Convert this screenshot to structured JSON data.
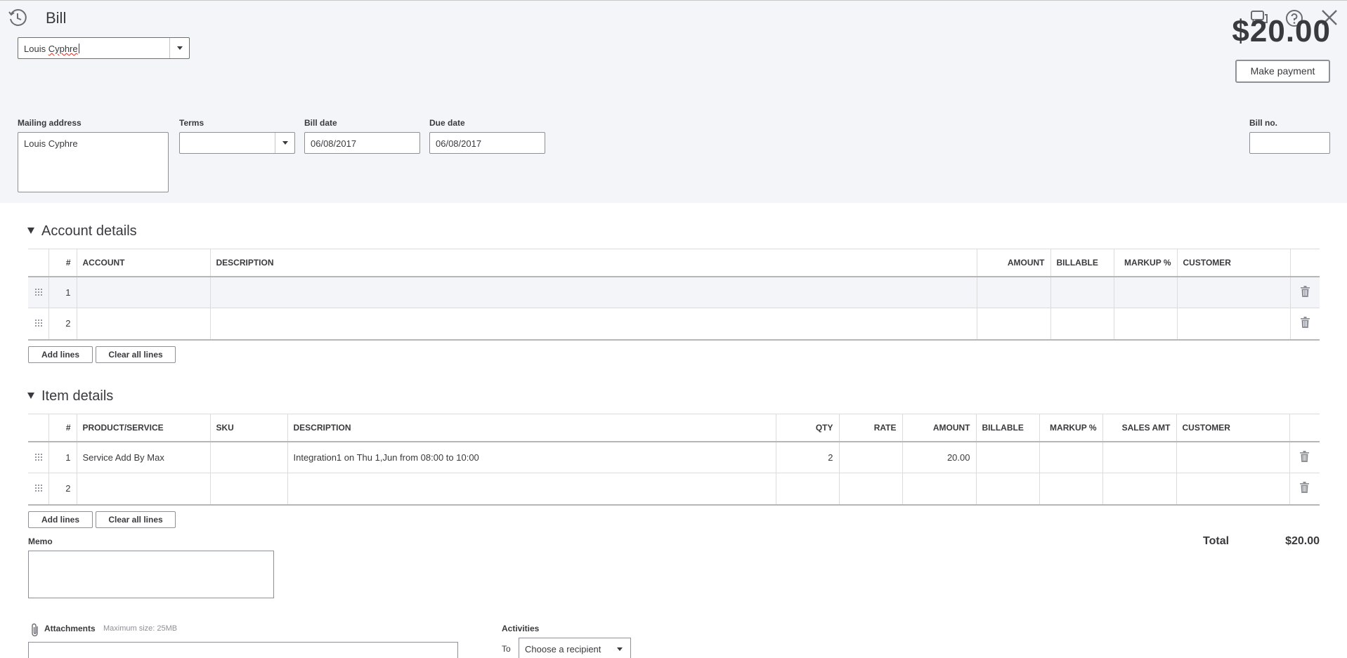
{
  "header": {
    "title": "Bill",
    "vendor": {
      "first": "Louis ",
      "squiggled": "Cyphre"
    },
    "balance_display": "$20.00",
    "make_payment_label": "Make payment",
    "mailing_address_label": "Mailing address",
    "mailing_address_value": "Louis Cyphre",
    "terms_label": "Terms",
    "terms_value": "",
    "bill_date_label": "Bill date",
    "bill_date_value": "06/08/2017",
    "due_date_label": "Due date",
    "due_date_value": "06/08/2017",
    "bill_no_label": "Bill no.",
    "bill_no_value": ""
  },
  "account_details": {
    "title": "Account details",
    "columns": [
      "#",
      "ACCOUNT",
      "DESCRIPTION",
      "AMOUNT",
      "BILLABLE",
      "MARKUP %",
      "CUSTOMER"
    ],
    "rows": [
      {
        "num": "1",
        "account": "",
        "description": "",
        "amount": "",
        "billable": "",
        "markup": "",
        "customer": ""
      },
      {
        "num": "2",
        "account": "",
        "description": "",
        "amount": "",
        "billable": "",
        "markup": "",
        "customer": ""
      }
    ],
    "add_lines_label": "Add lines",
    "clear_lines_label": "Clear all lines"
  },
  "item_details": {
    "title": "Item details",
    "columns": [
      "#",
      "PRODUCT/SERVICE",
      "SKU",
      "DESCRIPTION",
      "QTY",
      "RATE",
      "AMOUNT",
      "BILLABLE",
      "MARKUP %",
      "SALES AMT",
      "CUSTOMER"
    ],
    "rows": [
      {
        "num": "1",
        "product": "Service Add By Max",
        "sku": "",
        "description": "Integration1 on Thu 1,Jun from 08:00 to 10:00",
        "qty": "2",
        "rate": "",
        "amount": "20.00",
        "billable": "",
        "markup": "",
        "sales_amt": "",
        "customer": ""
      },
      {
        "num": "2",
        "product": "",
        "sku": "",
        "description": "",
        "qty": "",
        "rate": "",
        "amount": "",
        "billable": "",
        "markup": "",
        "sales_amt": "",
        "customer": ""
      }
    ],
    "add_lines_label": "Add lines",
    "clear_lines_label": "Clear all lines"
  },
  "footer": {
    "memo_label": "Memo",
    "total_label": "Total",
    "total_value": "$20.00",
    "attachments_label": "Attachments",
    "attachments_hint": "Maximum size: 25MB",
    "activities_label": "Activities",
    "to_label": "To",
    "recipient_placeholder": "Choose a recipient"
  },
  "colors": {
    "accent_green": "#2ca01c",
    "header_bg": "#f4f5f8",
    "text": "#393a3d",
    "muted": "#8d9096"
  },
  "icons": [
    "history-icon",
    "chat-icon",
    "help-icon",
    "close-icon",
    "grip-icon",
    "trash-icon",
    "paperclip-icon",
    "chevron-down-icon",
    "collapse-triangle-icon"
  ]
}
